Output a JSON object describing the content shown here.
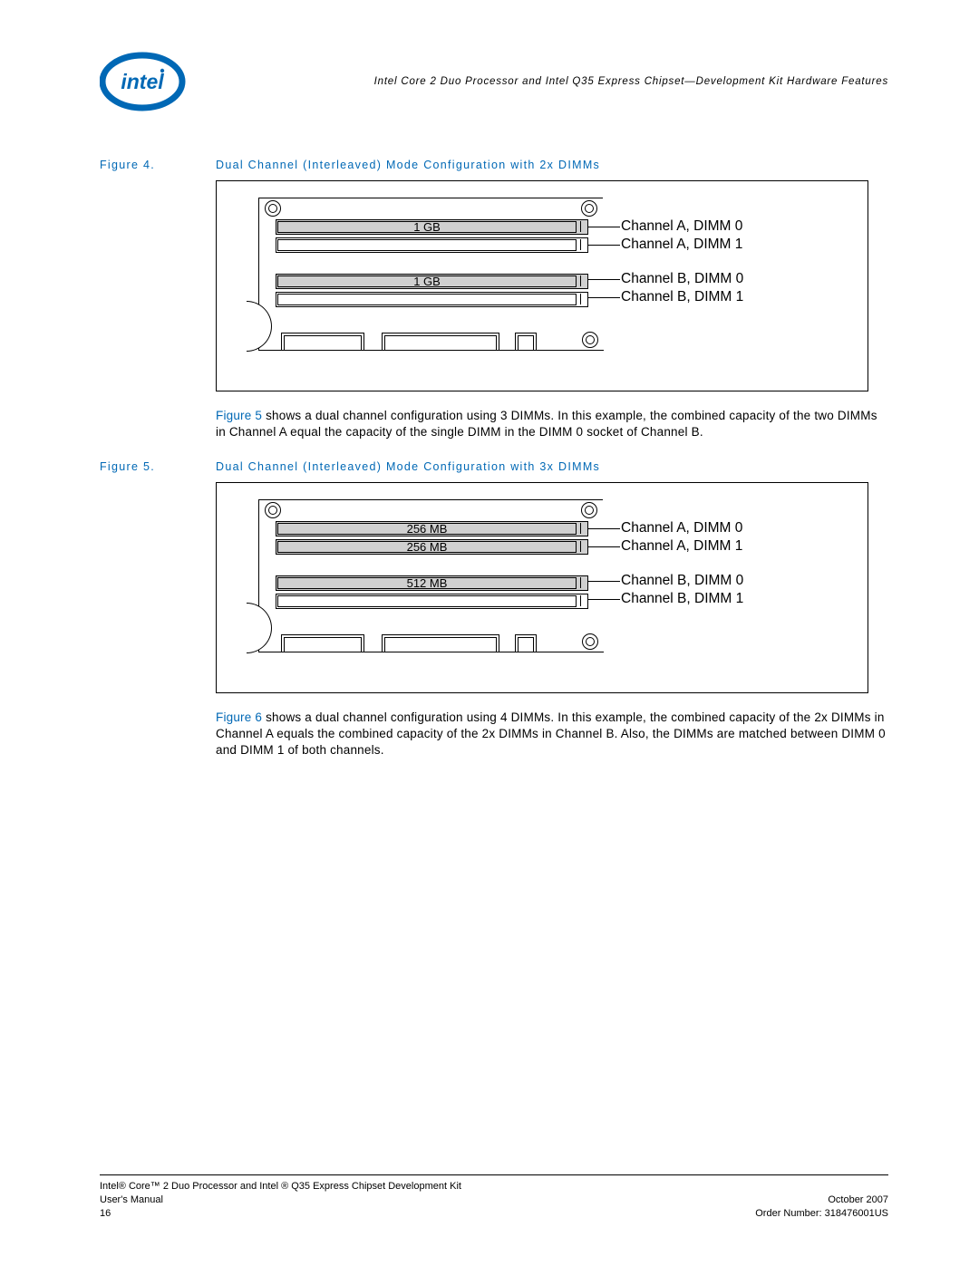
{
  "header": {
    "running_title": "Intel Core 2 Duo Processor and Intel Q35 Express Chipset—Development Kit Hardware Features"
  },
  "figure4": {
    "label": "Figure 4.",
    "title": "Dual Channel (Interleaved) Mode Configuration with 2x DIMMs",
    "slots": {
      "a0": "1 GB",
      "a1": "",
      "b0": "1 GB",
      "b1": ""
    },
    "labels": {
      "a0": "Channel A, DIMM 0",
      "a1": "Channel A, DIMM 1",
      "b0": "Channel B, DIMM 0",
      "b1": "Channel B, DIMM 1"
    }
  },
  "para1": {
    "ref": "Figure 5",
    "text": " shows a dual channel configuration using 3 DIMMs. In this example, the combined capacity of the two DIMMs in Channel A equal the capacity of the single DIMM in the DIMM 0 socket of Channel B."
  },
  "figure5": {
    "label": "Figure 5.",
    "title": "Dual Channel (Interleaved) Mode Configuration with 3x DIMMs",
    "slots": {
      "a0": "256 MB",
      "a1": "256 MB",
      "b0": "512 MB",
      "b1": ""
    },
    "labels": {
      "a0": "Channel A, DIMM 0",
      "a1": "Channel A, DIMM 1",
      "b0": "Channel B, DIMM 0",
      "b1": "Channel B, DIMM 1"
    }
  },
  "para2": {
    "ref": "Figure 6",
    "text": " shows a dual channel configuration using 4 DIMMs. In this example, the combined capacity of the 2x DIMMs in Channel A equals the combined capacity of the 2x DIMMs in Channel B. Also, the DIMMs are matched between DIMM 0 and DIMM 1 of both channels."
  },
  "footer": {
    "product_line": "Intel® Core™ 2 Duo Processor and Intel ® Q35 Express Chipset Development Kit",
    "left1": "User's Manual",
    "left2": "16",
    "right1": "October 2007",
    "right2": "Order Number: 318476001US"
  }
}
